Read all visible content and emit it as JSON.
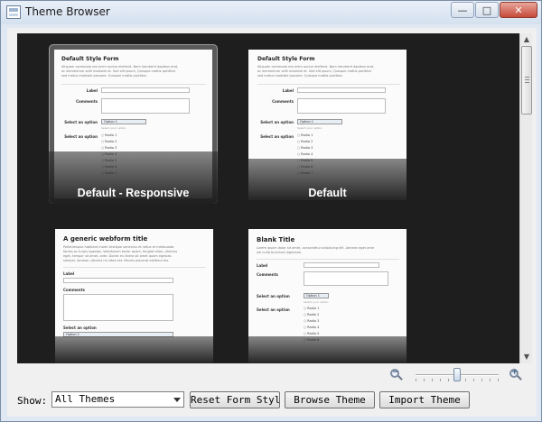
{
  "window": {
    "title": "Theme Browser",
    "controls": {
      "minimize": "—",
      "maximize": "□",
      "close": "✕"
    }
  },
  "themes": [
    {
      "name": "Default - Responsive",
      "selected": true,
      "preview": {
        "title": "Default Style Form",
        "desc_lines": [
          "Aliquam commodo nisi enim auctor eleifend. Nam hendrerit dapibus erat,",
          "ac elementum velit molestie et. Sed elit ipsum, Quisque mattis porttitor",
          "sed metus molestie posuere. Quisque mattis porttitor."
        ],
        "label": "Label",
        "comments": "Comments",
        "select_label": "Select an option",
        "select_value": "Option 1",
        "select_hint": "Select your option",
        "radio_label": "Select an option",
        "radios": [
          "Radio 1",
          "Radio 2",
          "Radio 3",
          "Radio 4",
          "Radio 5",
          "Radio 6",
          "Radio 7"
        ]
      }
    },
    {
      "name": "Default",
      "selected": false,
      "preview": {
        "title": "Default Style Form",
        "desc_lines": [
          "Aliquam commodo nisi enim auctor eleifend. Nam hendrerit dapibus erat,",
          "ac elementum velit molestie et. Sed elit ipsum, Quisque mattis porttitor",
          "sed metus molestie posuere. Quisque mattis porttitor."
        ],
        "label": "Label",
        "comments": "Comments",
        "select_label": "Select an option",
        "select_value": "Option 1",
        "select_hint": "Select your option",
        "radio_label": "Select an option",
        "radios": [
          "Radio 1",
          "Radio 2",
          "Radio 3",
          "Radio 4",
          "Radio 5",
          "Radio 6",
          "Radio 7"
        ]
      }
    },
    {
      "name": "",
      "selected": false,
      "preview": {
        "title": "A generic webform title",
        "desc_lines": [
          "Pellentesque habitant morbi tristique senectus et netus et malesuada",
          "fames ac turpis egestas. Vestibulum tortor quam, feugiat vitae, ultricies",
          "eget, tempor sit amet, ante. Donec eu libero sit amet quam egestas",
          "semper. Aenean ultricies mi vitae est. Mauris placerat eleifend leo."
        ],
        "label": "Label",
        "comments": "Comments",
        "select_label": "Select an option",
        "select_value": "Option 1"
      }
    },
    {
      "name": "",
      "selected": false,
      "preview": {
        "title": "Blank Title",
        "desc_lines": [
          "Lorem ipsum dolor sit amet, consectetur adipiscing elit. Aenean eget ante",
          "vel nulla tincidunt dignissim."
        ],
        "label": "Label",
        "comments": "Comments",
        "select_label": "Select an option",
        "select_value": "Option 1",
        "select_hint": "Select your option",
        "radio_label": "Select an option",
        "radios": [
          "Radio 1",
          "Radio 2",
          "Radio 3",
          "Radio 4",
          "Radio 5",
          "Radio 6"
        ]
      }
    }
  ],
  "zoom": {
    "level": 0.5,
    "zoom_out_icon": "zoom-out-icon",
    "zoom_in_icon": "zoom-in-icon"
  },
  "bottom": {
    "show_label": "Show:",
    "filter_value": "All Themes",
    "reset_button": "Reset Form Styles",
    "browse_button": "Browse Theme",
    "import_button": "Import Theme"
  },
  "colors": {
    "browser_bg": "#1e1e1e",
    "selected_card": "#5a5a5a",
    "window_frame": "#dfe8f3"
  }
}
